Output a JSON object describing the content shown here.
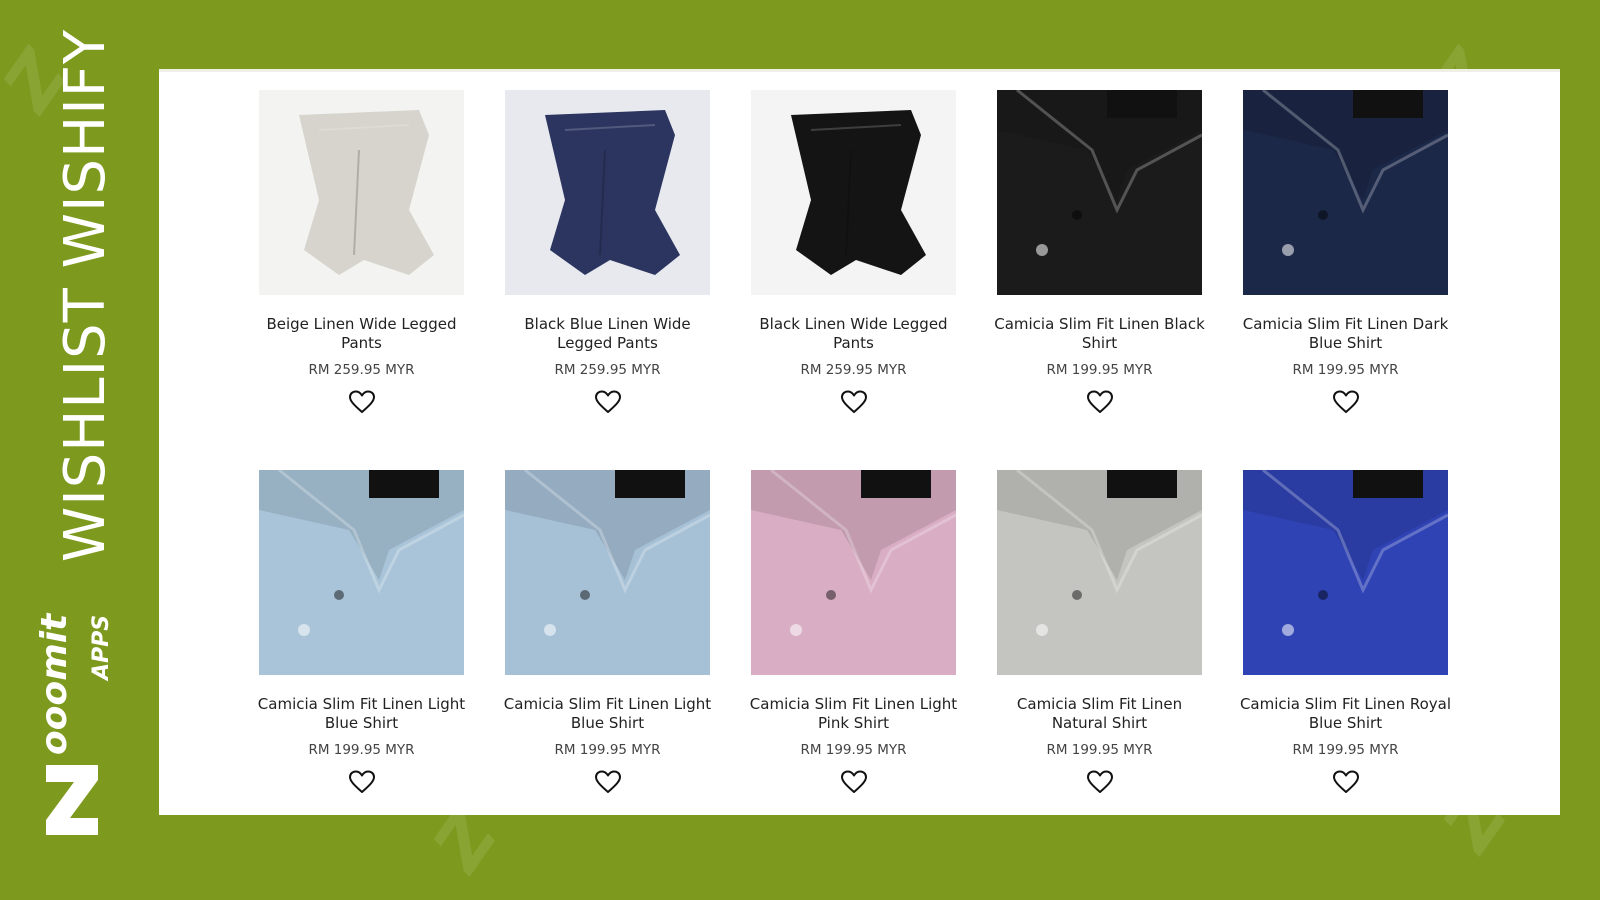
{
  "side_title": "WISHLIST WISHIFY",
  "brand_logo_name": "zooomit-apps-logo",
  "colors": {
    "background": "#7d9a1e",
    "panel": "#ffffff"
  },
  "products": [
    {
      "name": "Beige Linen Wide Legged Pants",
      "price": "RM 259.95 MYR",
      "kind": "pants",
      "color": "#d6d4cc",
      "bg": "#f3f3f1"
    },
    {
      "name": "Black Blue Linen Wide Legged Pants",
      "price": "RM 259.95 MYR",
      "kind": "pants",
      "color": "#2b3560",
      "bg": "#e7e9ee"
    },
    {
      "name": "Black Linen Wide Legged Pants",
      "price": "RM 259.95 MYR",
      "kind": "pants",
      "color": "#141414",
      "bg": "#f4f4f4"
    },
    {
      "name": "Camicia Slim Fit Linen Black Shirt",
      "price": "RM 199.95 MYR",
      "kind": "shirt",
      "color": "#1b1b1b",
      "bg": "#1b1b1b"
    },
    {
      "name": "Camicia Slim Fit Linen Dark Blue Shirt",
      "price": "RM 199.95 MYR",
      "kind": "shirt",
      "color": "#1c2848",
      "bg": "#1c2848"
    },
    {
      "name": "Camicia Slim Fit Linen Light Blue Shirt",
      "price": "RM 199.95 MYR",
      "kind": "shirt",
      "color": "#a9c4d8",
      "bg": "#a9c4d8"
    },
    {
      "name": "Camicia Slim Fit Linen Light Blue Shirt",
      "price": "RM 199.95 MYR",
      "kind": "shirt",
      "color": "#a6c0d6",
      "bg": "#a6c0d6"
    },
    {
      "name": "Camicia Slim Fit Linen Light Pink Shirt",
      "price": "RM 199.95 MYR",
      "kind": "shirt",
      "color": "#d9adc3",
      "bg": "#d9adc3"
    },
    {
      "name": "Camicia Slim Fit Linen Natural Shirt",
      "price": "RM 199.95 MYR",
      "kind": "shirt",
      "color": "#c4c4c0",
      "bg": "#c4c4c0"
    },
    {
      "name": "Camicia Slim Fit Linen Royal Blue Shirt",
      "price": "RM 199.95 MYR",
      "kind": "shirt",
      "color": "#2f43b5",
      "bg": "#2f43b5"
    }
  ],
  "wishlist_icon": "heart-icon"
}
